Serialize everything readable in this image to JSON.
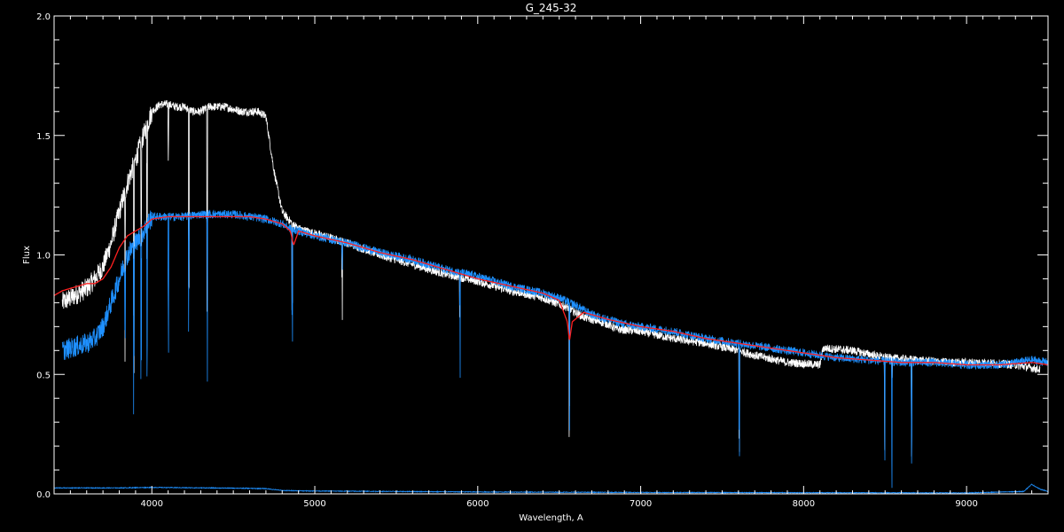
{
  "chart_data": {
    "type": "line",
    "title": "G_245-32",
    "xlabel": "Wavelength, A",
    "ylabel": "Flux",
    "xlim": [
      3400,
      9500
    ],
    "ylim": [
      0.0,
      2.0
    ],
    "x_ticks": [
      4000,
      5000,
      6000,
      7000,
      8000,
      9000
    ],
    "x_tick_labels": [
      "4000",
      "5000",
      "6000",
      "7000",
      "8000",
      "9000"
    ],
    "y_ticks": [
      0.0,
      0.5,
      1.0,
      1.5,
      2.0
    ],
    "y_tick_labels": [
      "0.0",
      "0.5",
      "1.0",
      "1.5",
      "2.0"
    ],
    "grid": false,
    "legend": "none",
    "background": "#000000",
    "series": [
      {
        "color": "#ffffff",
        "x": [
          3450,
          3500,
          3550,
          3600,
          3650,
          3700,
          3750,
          3800,
          3850,
          3900,
          3950,
          4000,
          4050,
          4100,
          4150,
          4200,
          4250,
          4300,
          4350,
          4400,
          4450,
          4500,
          4550,
          4600,
          4650,
          4700,
          4750,
          4800,
          4850,
          4900,
          5000,
          5200,
          5400,
          5600,
          5800,
          6000,
          6200,
          6400,
          6550,
          6650,
          6800,
          6850,
          7000,
          7200,
          7400,
          7600,
          7700,
          7900,
          8100,
          8120,
          8300,
          8500,
          8700,
          8900,
          9100,
          9300,
          9450
        ],
        "y": [
          0.8,
          0.82,
          0.84,
          0.86,
          0.9,
          0.95,
          1.05,
          1.18,
          1.3,
          1.4,
          1.5,
          1.6,
          1.63,
          1.63,
          1.62,
          1.62,
          1.6,
          1.6,
          1.62,
          1.62,
          1.62,
          1.61,
          1.6,
          1.6,
          1.6,
          1.58,
          1.35,
          1.18,
          1.14,
          1.11,
          1.09,
          1.05,
          1.0,
          0.96,
          0.92,
          0.89,
          0.85,
          0.82,
          0.78,
          0.74,
          0.71,
          0.69,
          0.68,
          0.65,
          0.63,
          0.6,
          0.58,
          0.55,
          0.54,
          0.61,
          0.6,
          0.57,
          0.56,
          0.55,
          0.55,
          0.54,
          0.52
        ]
      },
      {
        "color": "#1e90ff",
        "x": [
          3450,
          3500,
          3550,
          3600,
          3650,
          3700,
          3750,
          3800,
          3850,
          3900,
          3950,
          4000,
          4100,
          4200,
          4300,
          4400,
          4500,
          4600,
          4700,
          4800,
          4850,
          4900,
          5000,
          5200,
          5400,
          5600,
          5800,
          6000,
          6200,
          6400,
          6500,
          6600,
          6700,
          6800,
          6900,
          7000,
          7200,
          7400,
          7600,
          7800,
          8000,
          8200,
          8400,
          8600,
          8800,
          9000,
          9200,
          9400,
          9500
        ],
        "y": [
          0.6,
          0.61,
          0.62,
          0.63,
          0.65,
          0.7,
          0.8,
          0.9,
          1.0,
          1.05,
          1.1,
          1.16,
          1.16,
          1.16,
          1.17,
          1.17,
          1.17,
          1.16,
          1.15,
          1.13,
          1.11,
          1.1,
          1.08,
          1.05,
          1.01,
          0.98,
          0.94,
          0.91,
          0.87,
          0.84,
          0.82,
          0.79,
          0.75,
          0.73,
          0.71,
          0.7,
          0.68,
          0.65,
          0.63,
          0.61,
          0.59,
          0.57,
          0.56,
          0.55,
          0.55,
          0.54,
          0.54,
          0.56,
          0.55
        ]
      },
      {
        "color": "#ff2020",
        "x": [
          3400,
          3450,
          3500,
          3550,
          3600,
          3650,
          3700,
          3750,
          3800,
          3850,
          3900,
          3950,
          4000,
          4100,
          4200,
          4300,
          4400,
          4500,
          4600,
          4700,
          4800,
          4850,
          4870,
          4900,
          5000,
          5200,
          5400,
          5600,
          5800,
          6000,
          6200,
          6400,
          6500,
          6550,
          6563,
          6580,
          6650,
          6800,
          7000,
          7200,
          7400,
          7600,
          7800,
          8000,
          8200,
          8400,
          8600,
          8800,
          9000,
          9200,
          9400,
          9500
        ],
        "y": [
          0.83,
          0.85,
          0.86,
          0.87,
          0.88,
          0.88,
          0.9,
          0.95,
          1.03,
          1.08,
          1.1,
          1.12,
          1.15,
          1.16,
          1.16,
          1.16,
          1.16,
          1.16,
          1.16,
          1.15,
          1.13,
          1.1,
          1.04,
          1.1,
          1.08,
          1.05,
          1.01,
          0.98,
          0.94,
          0.9,
          0.87,
          0.84,
          0.81,
          0.72,
          0.64,
          0.72,
          0.76,
          0.73,
          0.7,
          0.68,
          0.65,
          0.63,
          0.61,
          0.59,
          0.57,
          0.56,
          0.55,
          0.55,
          0.54,
          0.54,
          0.55,
          0.54
        ]
      },
      {
        "color": "#1e90ff",
        "x": [
          3400,
          3800,
          4000,
          4500,
          4700,
          4800,
          5000,
          6000,
          7000,
          8000,
          9000,
          9350,
          9400,
          9450,
          9500
        ],
        "y": [
          0.025,
          0.025,
          0.027,
          0.024,
          0.022,
          0.014,
          0.012,
          0.008,
          0.006,
          0.005,
          0.004,
          0.01,
          0.04,
          0.02,
          0.01
        ]
      }
    ],
    "absorption_lines": [
      3835,
      3889,
      3934,
      3970,
      4101,
      4227,
      4340,
      4861,
      5167,
      5890,
      6563,
      7605,
      8498,
      8542,
      8662
    ]
  }
}
